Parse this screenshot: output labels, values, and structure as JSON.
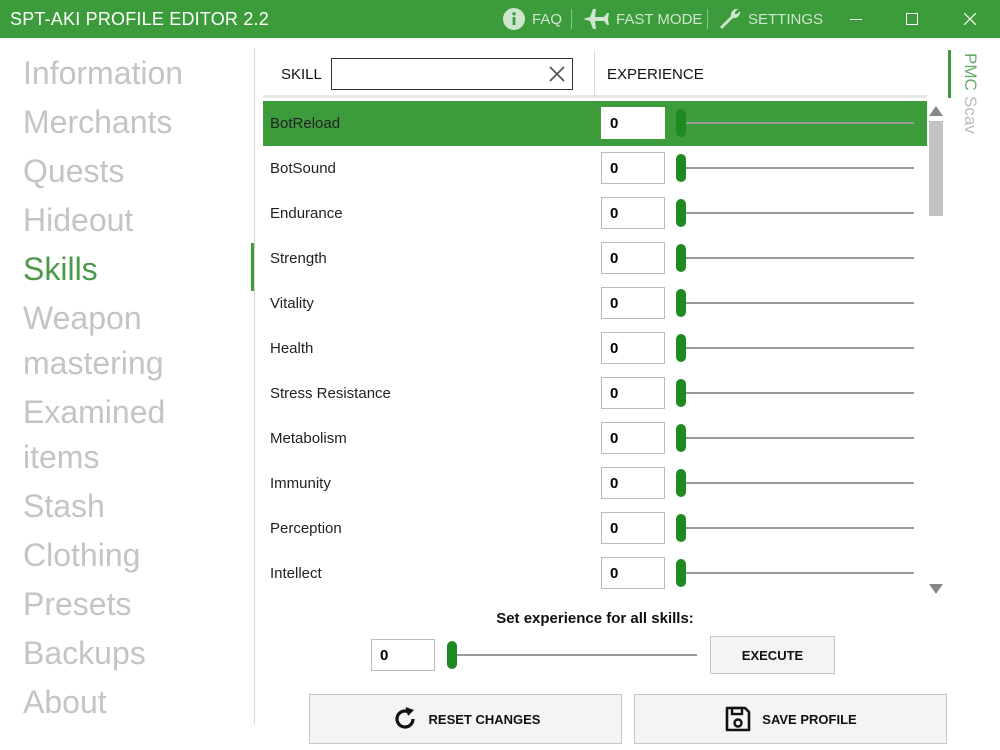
{
  "titlebar": {
    "title": "SPT-AKI PROFILE EDITOR  2.2",
    "faq_label": "FAQ",
    "fast_mode_label": "FAST MODE",
    "settings_label": "SETTINGS",
    "icons": [
      "info-icon",
      "airplane-icon",
      "wrench-icon",
      "minimize-icon",
      "maximize-icon",
      "close-icon"
    ]
  },
  "nav": {
    "items": [
      {
        "label": "Information"
      },
      {
        "label": "Merchants"
      },
      {
        "label": "Quests"
      },
      {
        "label": "Hideout"
      },
      {
        "label": "Skills"
      },
      {
        "label": "Weapon"
      },
      {
        "label": "mastering"
      },
      {
        "label": "Examined"
      },
      {
        "label": "items"
      },
      {
        "label": "Stash"
      },
      {
        "label": "Clothing"
      },
      {
        "label": "Presets"
      },
      {
        "label": "Backups"
      },
      {
        "label": "About"
      }
    ],
    "active": "Skills"
  },
  "table": {
    "skill_header": "SKILL",
    "experience_header": "EXPERIENCE",
    "search_value": "",
    "rows": [
      {
        "name": "BotReload",
        "value": "0",
        "level": 0
      },
      {
        "name": "BotSound",
        "value": "0",
        "level": 0
      },
      {
        "name": "Endurance",
        "value": "0",
        "level": 0
      },
      {
        "name": "Strength",
        "value": "0",
        "level": 0
      },
      {
        "name": "Vitality",
        "value": "0",
        "level": 0
      },
      {
        "name": "Health",
        "value": "0",
        "level": 0
      },
      {
        "name": "Stress Resistance",
        "value": "0",
        "level": 0
      },
      {
        "name": "Metabolism",
        "value": "0",
        "level": 0
      },
      {
        "name": "Immunity",
        "value": "0",
        "level": 0
      },
      {
        "name": "Perception",
        "value": "0",
        "level": 0
      },
      {
        "name": "Intellect",
        "value": "0",
        "level": 0
      }
    ],
    "selected_index": 0
  },
  "side_tabs": {
    "pmc_label": "PMC",
    "scav_label": "Scav",
    "active": "PMC"
  },
  "bulk": {
    "label": "Set experience for all skills:",
    "value": "0",
    "level": 0,
    "execute_label": "EXECUTE"
  },
  "actions": {
    "reset_label": "RESET CHANGES",
    "save_label": "SAVE PROFILE"
  },
  "colors": {
    "accent": "#3c9c3c",
    "slider_thumb": "#1f8a1f",
    "nav_inactive": "#c4c4c4"
  }
}
